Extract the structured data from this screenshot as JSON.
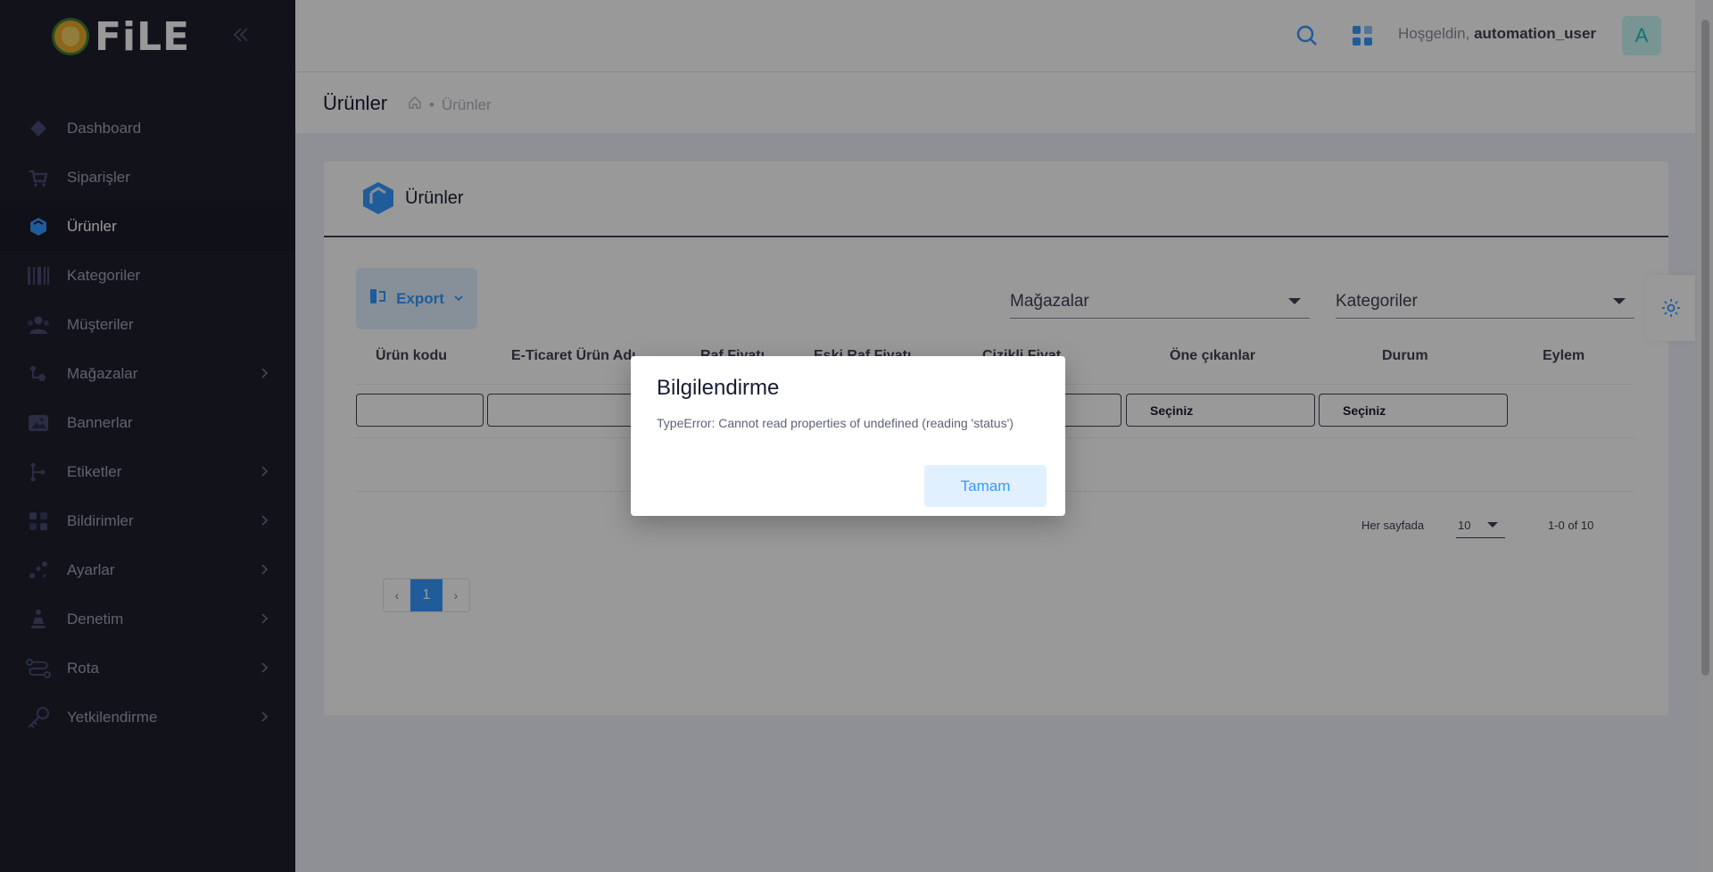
{
  "brand": {
    "name": "FiLE"
  },
  "sidebar": {
    "items": [
      {
        "label": "Dashboard",
        "icon": "diamond-icon"
      },
      {
        "label": "Siparişler",
        "icon": "cart-icon"
      },
      {
        "label": "Ürünler",
        "icon": "box-icon",
        "active": true
      },
      {
        "label": "Kategoriler",
        "icon": "barcode-icon"
      },
      {
        "label": "Müşteriler",
        "icon": "users-icon"
      },
      {
        "label": "Mağazalar",
        "icon": "store-icon",
        "expandable": true
      },
      {
        "label": "Bannerlar",
        "icon": "image-icon"
      },
      {
        "label": "Etiketler",
        "icon": "tag-icon",
        "expandable": true
      },
      {
        "label": "Bildirimler",
        "icon": "bell-grid-icon",
        "expandable": true
      },
      {
        "label": "Ayarlar",
        "icon": "settings-dots-icon",
        "expandable": true
      },
      {
        "label": "Denetim",
        "icon": "audit-icon",
        "expandable": true
      },
      {
        "label": "Rota",
        "icon": "route-icon",
        "expandable": true
      },
      {
        "label": "Yetkilendirme",
        "icon": "key-icon",
        "expandable": true
      }
    ]
  },
  "header": {
    "welcome_prefix": "Hoşgeldin,",
    "username": "automation_user",
    "avatar_letter": "A"
  },
  "subheader": {
    "title": "Ürünler",
    "breadcrumb": "Ürünler"
  },
  "card": {
    "title": "Ürünler",
    "export_label": "Export",
    "filters": {
      "stores_placeholder": "Mağazalar",
      "categories_placeholder": "Kategoriler"
    },
    "columns": [
      "Ürün kodu",
      "E-Ticaret Ürün Adı",
      "Raf Fiyatı",
      "Eski Raf Fiyatı",
      "Çizikli Fiyat",
      "Öne çıkanlar",
      "Durum",
      "Eylem"
    ],
    "select_placeholder": "Seçiniz",
    "pagination": {
      "per_page_label": "Her sayfada",
      "per_page_value": "10",
      "range": "1-0 of 10",
      "current_page": "1",
      "prev": "‹",
      "next": "›"
    }
  },
  "modal": {
    "title": "Bilgilendirme",
    "message": "TypeError: Cannot read properties of undefined (reading 'status')",
    "ok_label": "Tamam"
  },
  "colors": {
    "sidebar_bg": "#1e1e2d",
    "accent": "#3699ff",
    "accent_light": "#e1f0ff",
    "avatar_bg": "#c9f7f5",
    "avatar_fg": "#1bc5bd"
  }
}
